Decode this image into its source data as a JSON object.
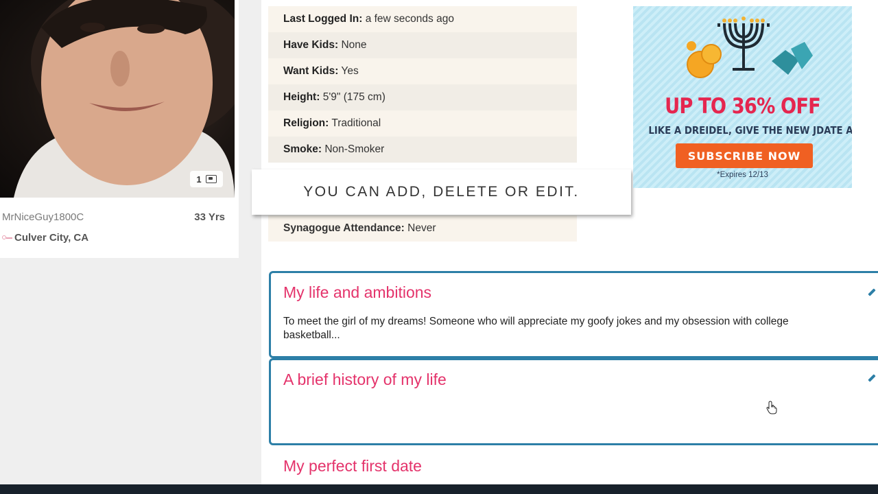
{
  "profile": {
    "photo_count": "1",
    "username": "MrNiceGuy1800C",
    "age": "33 Yrs",
    "location": "Culver City, CA"
  },
  "details": [
    {
      "label": "Last Logged In:",
      "value": "a few seconds ago"
    },
    {
      "label": "Have Kids:",
      "value": "None"
    },
    {
      "label": "Want Kids:",
      "value": "Yes"
    },
    {
      "label": "Height:",
      "value": "5'9\" (175 cm)"
    },
    {
      "label": "Religion:",
      "value": "Traditional"
    },
    {
      "label": "Smoke:",
      "value": "Non-Smoker"
    }
  ],
  "details_last": {
    "label": "Synagogue Attendance:",
    "value": "Never"
  },
  "tooltip": "YOU CAN ADD, DELETE OR EDIT.",
  "ad": {
    "headline": "UP TO 36% OFF",
    "subline": "LIKE A DREIDEL, GIVE THE NEW JDATE A SPIN!",
    "button": "SUBSCRIBE NOW",
    "expiry": "*Expires 12/13"
  },
  "essays": [
    {
      "title": "My life and ambitions",
      "body": "To meet the girl of my dreams! Someone who will appreciate my goofy jokes and my obsession with college basketball..."
    },
    {
      "title": "A brief history of my life",
      "body": ""
    },
    {
      "title": "My perfect first date",
      "body": ""
    }
  ],
  "colors": {
    "accent_pink": "#e4336b",
    "border_blue": "#2d7fa7",
    "ad_orange": "#f06022",
    "ad_red": "#e5264f"
  }
}
